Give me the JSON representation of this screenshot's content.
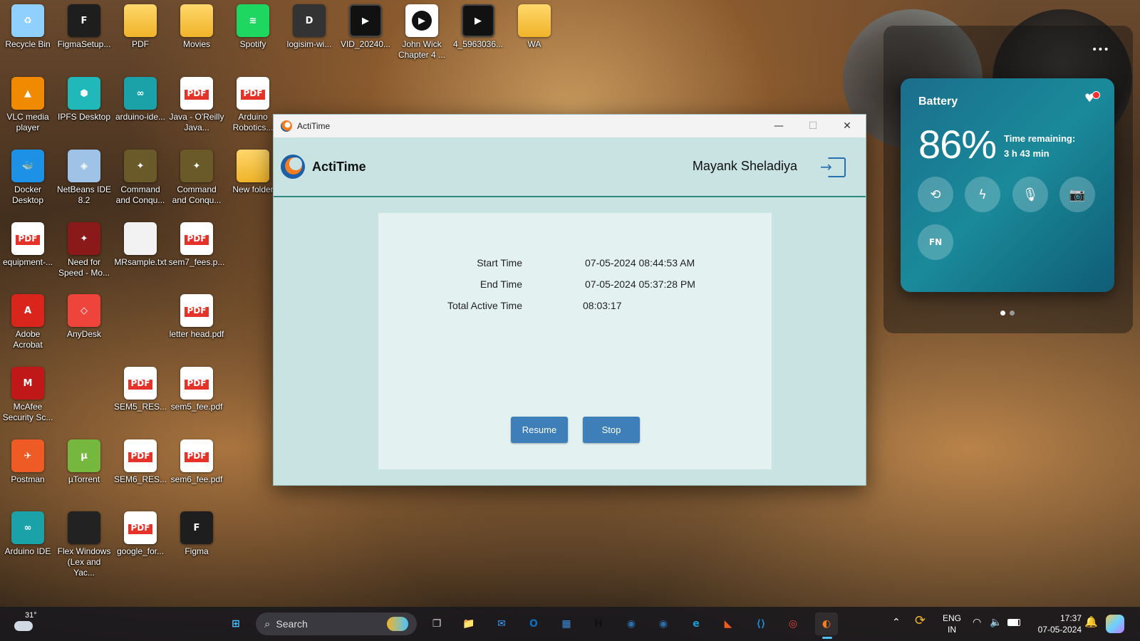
{
  "desktop_icons": [
    {
      "label": "Recycle Bin",
      "icon": "recycle-bin-icon",
      "glyph": "♻",
      "color": "#8fd0ff"
    },
    {
      "label": "FigmaSetup...",
      "icon": "figma-icon",
      "glyph": "F",
      "color": "#1e1e1e"
    },
    {
      "label": "PDF",
      "icon": "folder-icon",
      "glyph": "",
      "color": "folder"
    },
    {
      "label": "Movies",
      "icon": "folder-icon",
      "glyph": "",
      "color": "folder"
    },
    {
      "label": "Spotify",
      "icon": "spotify-icon",
      "glyph": "≋",
      "color": "#1ed760"
    },
    {
      "label": "logisim-wi...",
      "icon": "logisim-icon",
      "glyph": "D",
      "color": "#333333"
    },
    {
      "label": "VID_20240...",
      "icon": "video-file-icon",
      "glyph": "▶",
      "color": "video"
    },
    {
      "label": "John Wick Chapter 4 ...",
      "icon": "media-player-icon",
      "glyph": "▶",
      "color": "play"
    },
    {
      "label": "4_5963036...",
      "icon": "video-file-icon",
      "glyph": "▶",
      "color": "video"
    },
    {
      "label": "WA",
      "icon": "folder-icon",
      "glyph": "",
      "color": "folder"
    },
    {
      "label": "VLC media player",
      "icon": "vlc-icon",
      "glyph": "▲",
      "color": "#f08a00"
    },
    {
      "label": "IPFS Desktop",
      "icon": "ipfs-icon",
      "glyph": "⬢",
      "color": "#20b8b8"
    },
    {
      "label": "arduino-ide...",
      "icon": "arduino-icon",
      "glyph": "∞",
      "color": "#1aa2a8"
    },
    {
      "label": "Java - O'Reilly Java...",
      "icon": "pdf-file-icon",
      "glyph": "PDF",
      "color": "pdf"
    },
    {
      "label": "Arduino Robotics...",
      "icon": "pdf-file-icon",
      "glyph": "PDF",
      "color": "pdf"
    },
    {
      "label": "Docker Desktop",
      "icon": "docker-icon",
      "glyph": "🐳",
      "color": "#1d91e6"
    },
    {
      "label": "NetBeans IDE 8.2",
      "icon": "netbeans-icon",
      "glyph": "◈",
      "color": "#9ec3e6"
    },
    {
      "label": "Command and Conqu...",
      "icon": "game-icon",
      "glyph": "✦",
      "color": "#6a5a2a"
    },
    {
      "label": "Command and Conqu...",
      "icon": "game-icon",
      "glyph": "✦",
      "color": "#6a5a2a"
    },
    {
      "label": "New folder",
      "icon": "folder-icon",
      "glyph": "",
      "color": "folder"
    },
    {
      "label": "equipment-...",
      "icon": "pdf-file-icon",
      "glyph": "PDF",
      "color": "pdf"
    },
    {
      "label": "Need for Speed - Mo...",
      "icon": "game-icon",
      "glyph": "✦",
      "color": "#8a1a1a"
    },
    {
      "label": "MRsample.txt",
      "icon": "text-file-icon",
      "glyph": "",
      "color": "doc"
    },
    {
      "label": "sem7_fees.p...",
      "icon": "pdf-file-icon",
      "glyph": "PDF",
      "color": "pdf"
    },
    {
      "label": "Adobe Acrobat",
      "icon": "acrobat-icon",
      "glyph": "A",
      "color": "#d9251c"
    },
    {
      "label": "AnyDesk",
      "icon": "anydesk-icon",
      "glyph": "◇",
      "color": "#ef443b"
    },
    {
      "label": "letter head.pdf",
      "icon": "pdf-file-icon",
      "glyph": "PDF",
      "color": "pdf"
    },
    {
      "label": "McAfee Security Sc...",
      "icon": "mcafee-icon",
      "glyph": "M",
      "color": "#c01818"
    },
    {
      "label": "SEM5_RES...",
      "icon": "pdf-file-icon",
      "glyph": "PDF",
      "color": "pdf"
    },
    {
      "label": "sem5_fee.pdf",
      "icon": "pdf-file-icon",
      "glyph": "PDF",
      "color": "pdf"
    },
    {
      "label": "Postman",
      "icon": "postman-icon",
      "glyph": "✈",
      "color": "#ef5b25"
    },
    {
      "label": "µTorrent",
      "icon": "utorrent-icon",
      "glyph": "µ",
      "color": "#76b83f"
    },
    {
      "label": "SEM6_RES...",
      "icon": "pdf-file-icon",
      "glyph": "PDF",
      "color": "pdf"
    },
    {
      "label": "sem6_fee.pdf",
      "icon": "pdf-file-icon",
      "glyph": "PDF",
      "color": "pdf"
    },
    {
      "label": "Arduino IDE",
      "icon": "arduino-icon",
      "glyph": "∞",
      "color": "#1aa2a8"
    },
    {
      "label": "Flex Windows (Lex and Yac...",
      "icon": "flex-icon",
      "glyph": "",
      "color": "#222222"
    },
    {
      "label": "google_for...",
      "icon": "pdf-file-icon",
      "glyph": "PDF",
      "color": "pdf"
    },
    {
      "label": "Figma",
      "icon": "figma-icon",
      "glyph": "F",
      "color": "#1e1e1e"
    }
  ],
  "window": {
    "title": "ActiTime",
    "app_name": "ActiTime",
    "user_name": "Mayank Sheladiya",
    "start_label": "Start Time",
    "start_value": "07-05-2024 08:44:53 AM",
    "end_label": "End Time",
    "end_value": "07-05-2024 05:37:28 PM",
    "total_label": "Total Active Time",
    "total_value": "08:03:17",
    "resume_label": "Resume",
    "stop_label": "Stop",
    "minimize_glyph": "—",
    "maximize_glyph": "☐",
    "close_glyph": "✕"
  },
  "battery": {
    "title": "Battery",
    "percent": "86%",
    "remaining_label": "Time remaining:",
    "remaining_value": "3 h 43 min",
    "buttons": [
      {
        "name": "battery-saver-icon",
        "glyph": "⟲"
      },
      {
        "name": "charge-icon",
        "glyph": "ϟ"
      },
      {
        "name": "microphone-icon",
        "glyph": "🎙"
      },
      {
        "name": "camera-icon",
        "glyph": "📷"
      },
      {
        "name": "fn-icon",
        "glyph": "FN"
      }
    ],
    "menu_glyph": "•••"
  },
  "taskbar": {
    "weather_temp": "31°",
    "search_placeholder": "Search",
    "apps": [
      {
        "name": "start-icon",
        "glyph": "⊞",
        "color": "#4cc2ff"
      },
      {
        "name": "task-view-icon",
        "glyph": "❐",
        "color": "#d0d0d0"
      },
      {
        "name": "file-explorer-icon",
        "glyph": "📁",
        "color": "#f0b429"
      },
      {
        "name": "mail-icon",
        "glyph": "✉",
        "color": "#3aa0ff"
      },
      {
        "name": "outlook-icon",
        "glyph": "O",
        "color": "#0f6cbd"
      },
      {
        "name": "store-icon",
        "glyph": "▦",
        "color": "#3b8fe0"
      },
      {
        "name": "hackerrank-icon",
        "glyph": "H",
        "color": "#111111"
      },
      {
        "name": "app-icon-1",
        "glyph": "◉",
        "color": "#2a6fae"
      },
      {
        "name": "app-icon-2",
        "glyph": "◉",
        "color": "#2a6fae"
      },
      {
        "name": "edge-icon",
        "glyph": "e",
        "color": "#1aa0d8"
      },
      {
        "name": "app-icon-3",
        "glyph": "◣",
        "color": "#f05a24"
      },
      {
        "name": "vscode-icon",
        "glyph": "⟨⟩",
        "color": "#1f8ad2"
      },
      {
        "name": "chrome-icon",
        "glyph": "◎",
        "color": "#e94235"
      },
      {
        "name": "actitime-icon",
        "glyph": "◐",
        "color": "#f47b20"
      }
    ],
    "lang_top": "ENG",
    "lang_bottom": "IN",
    "time": "17:37",
    "date": "07-05-2024"
  }
}
